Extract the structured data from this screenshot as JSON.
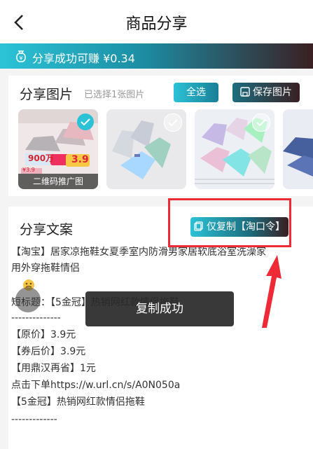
{
  "header": {
    "title": "商品分享"
  },
  "banner": {
    "text": "分享成功可赚 ¥0.34"
  },
  "images": {
    "title": "分享图片",
    "selected": "已选择1张图片",
    "select_all": "全选",
    "save": "保存图片",
    "promo_price_big": "900万",
    "promo_price_tag": "3.9",
    "promo_price_sub": "¥3.9",
    "qr_label": "二维码推广图"
  },
  "copy": {
    "title": "分享文案",
    "copy_only": "仅复制【淘口令】",
    "lines": [
      "【淘宝】居家凉拖鞋女夏季室内防滑男家居软底浴室洗澡家",
      "用外穿拖鞋情侣",
      "短标题：【5金冠】热销网红款情侣拖鞋",
      "--------------",
      "【原价】3.9元",
      "【券后价】3.9元",
      "【用鼎汉再省】1元",
      "点击下单https://w.url.cn/s/A0N050a",
      "【5金冠】热销网红款情侣拖鞋",
      "-------------"
    ]
  },
  "toast": {
    "text": "复制成功"
  },
  "colors": {
    "accent": "#2bc2d6",
    "dark": "#3a1f22",
    "annotation": "#ee2a37"
  }
}
